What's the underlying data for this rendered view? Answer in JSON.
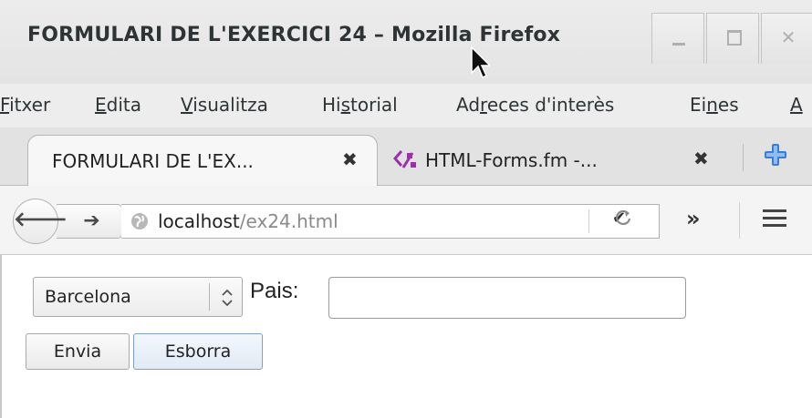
{
  "window": {
    "title": "FORMULARI DE L'EXERCICI 24 – Mozilla Firefox",
    "controls": {
      "minimize": "_",
      "maximize": "□",
      "close": "✕"
    }
  },
  "menubar": {
    "items": [
      {
        "pre": "",
        "u": "F",
        "post": "itxer"
      },
      {
        "pre": "",
        "u": "E",
        "post": "dita"
      },
      {
        "pre": "",
        "u": "V",
        "post": "isualitza"
      },
      {
        "pre": "Hi",
        "u": "s",
        "post": "torial"
      },
      {
        "pre": "Ad",
        "u": "r",
        "post": "eces d'interès"
      },
      {
        "pre": "Ei",
        "u": "n",
        "post": "es"
      },
      {
        "pre": "",
        "u": "A",
        "post": ""
      }
    ]
  },
  "tabs": [
    {
      "label": "FORMULARI DE L'EX...",
      "close": "✖",
      "active": true
    },
    {
      "label": "HTML-Forms.fm -...",
      "close": "✖",
      "active": false
    }
  ],
  "navbar": {
    "url_host": "localhost",
    "url_path": "/ex24.html",
    "dropdown_glyph": "✔",
    "reload_glyph": "C",
    "overflow_glyph": "»"
  },
  "form": {
    "city_select_value": "Barcelona",
    "pais_label": "Pais:",
    "pais_value": "",
    "submit_label": "Envia",
    "reset_label": "Esborra"
  },
  "colors": {
    "accent_tab_icon": "#9b2fae",
    "newtab_icon": "#3a7fd5"
  }
}
